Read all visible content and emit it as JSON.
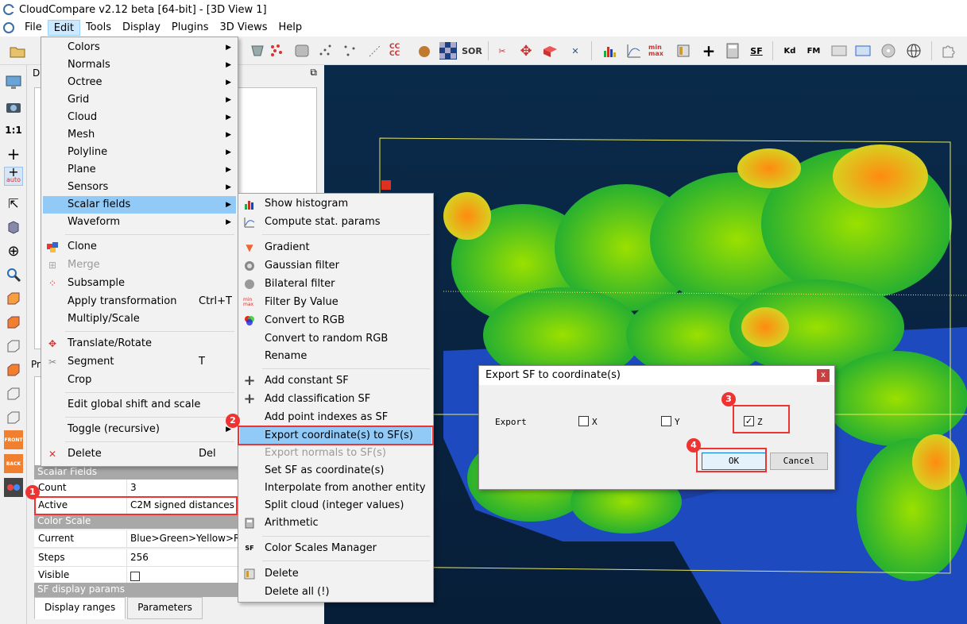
{
  "window": {
    "title": "CloudCompare v2.12 beta [64-bit] - [3D View 1]"
  },
  "menubar": [
    "File",
    "Edit",
    "Tools",
    "Display",
    "Plugins",
    "3D Views",
    "Help"
  ],
  "toolbar": {
    "cccc_label": "CC CC",
    "sor_label": "SOR",
    "minmax_label": "min max",
    "sf_label": "SF",
    "kd_label": "Kd",
    "fm_label": "FM"
  },
  "leftbar": {
    "scale_label": "1:1",
    "auto_label": "auto",
    "front_label": "FRONT",
    "back_label": "BACK"
  },
  "panels": {
    "db_label": "DB",
    "props_label": "Pr"
  },
  "properties": {
    "scalar_fields_header": "Scalar Fields",
    "count_key": "Count",
    "count_value": "3",
    "active_key": "Active",
    "active_value": "C2M signed distances",
    "color_scale_header": "Color Scale",
    "current_key": "Current",
    "current_value": "Blue>Green>Yellow>Re",
    "steps_key": "Steps",
    "steps_value": "256",
    "visible_key": "Visible",
    "sf_display_header": "SF display params",
    "tabs": [
      "Display ranges",
      "Parameters"
    ]
  },
  "edit_menu": {
    "items": [
      "Colors",
      "Normals",
      "Octree",
      "Grid",
      "Cloud",
      "Mesh",
      "Polyline",
      "Plane",
      "Sensors",
      "Scalar fields",
      "Waveform",
      "Clone",
      "Merge",
      "Subsample",
      "Apply transformation",
      "Multiply/Scale",
      "Translate/Rotate",
      "Segment",
      "Crop",
      "Edit global shift and scale",
      "Toggle (recursive)",
      "Delete"
    ],
    "shortcuts": {
      "apply": "Ctrl+T",
      "segment": "T",
      "delete": "Del"
    }
  },
  "sf_submenu": {
    "items": [
      "Show histogram",
      "Compute stat. params",
      "Gradient",
      "Gaussian filter",
      "Bilateral filter",
      "Filter By Value",
      "Convert to RGB",
      "Convert to random RGB",
      "Rename",
      "Add constant SF",
      "Add classification SF",
      "Add point indexes as SF",
      "Export coordinate(s) to SF(s)",
      "Export normals to SF(s)",
      "Set SF as coordinate(s)",
      "Interpolate from another entity",
      "Split cloud (integer values)",
      "Arithmetic",
      "Color Scales Manager",
      "Delete",
      "Delete all (!)"
    ]
  },
  "dialog": {
    "title": "Export SF to coordinate(s)",
    "close": "x",
    "export_label": "Export",
    "x_label": "X",
    "y_label": "Y",
    "z_label": "Z",
    "x_checked": false,
    "y_checked": false,
    "z_checked": true,
    "ok_label": "OK",
    "cancel_label": "Cancel"
  },
  "annotations": [
    "1",
    "2",
    "3",
    "4"
  ]
}
